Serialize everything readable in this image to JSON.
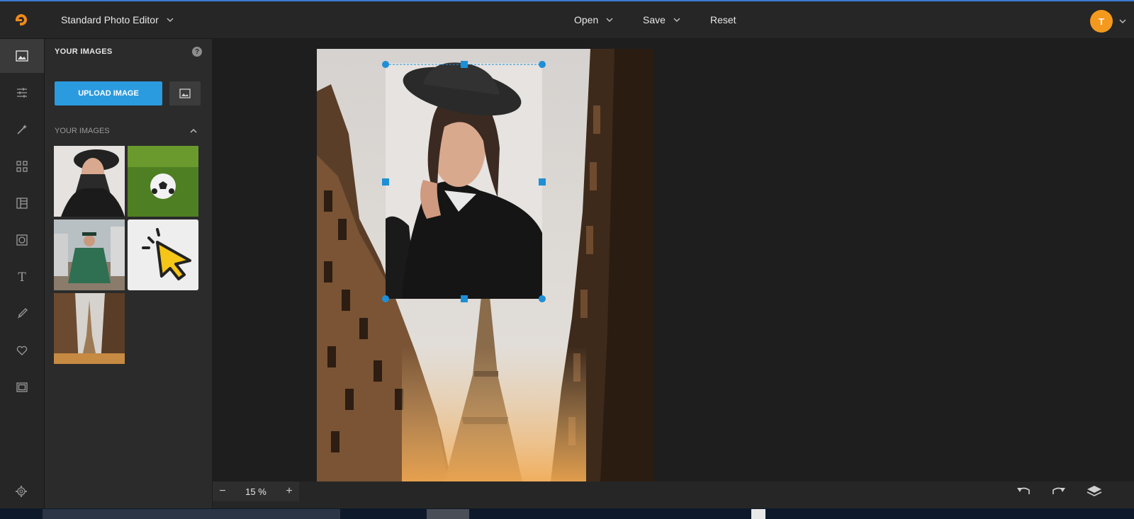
{
  "header": {
    "editor_mode": "Standard Photo Editor",
    "menu": {
      "open": "Open",
      "save": "Save",
      "reset": "Reset"
    },
    "avatar_initial": "T"
  },
  "panel": {
    "title": "YOUR IMAGES",
    "help": "?",
    "upload_label": "UPLOAD IMAGE",
    "section_label": "YOUR IMAGES"
  },
  "zoom": {
    "value": "15 %",
    "minus": "−",
    "plus": "+"
  },
  "colors": {
    "accent": "#2b9be0",
    "avatar": "#f39a1e",
    "selection": "#1e8fd6"
  },
  "icons": {
    "rail": [
      "image-icon",
      "sliders-icon",
      "magic-wand-icon",
      "grid-icon",
      "layout-icon",
      "frame-icon",
      "text-icon",
      "brush-icon",
      "heart-icon",
      "border-icon"
    ],
    "bottom": [
      "undo-icon",
      "redo-icon",
      "layers-icon"
    ]
  }
}
